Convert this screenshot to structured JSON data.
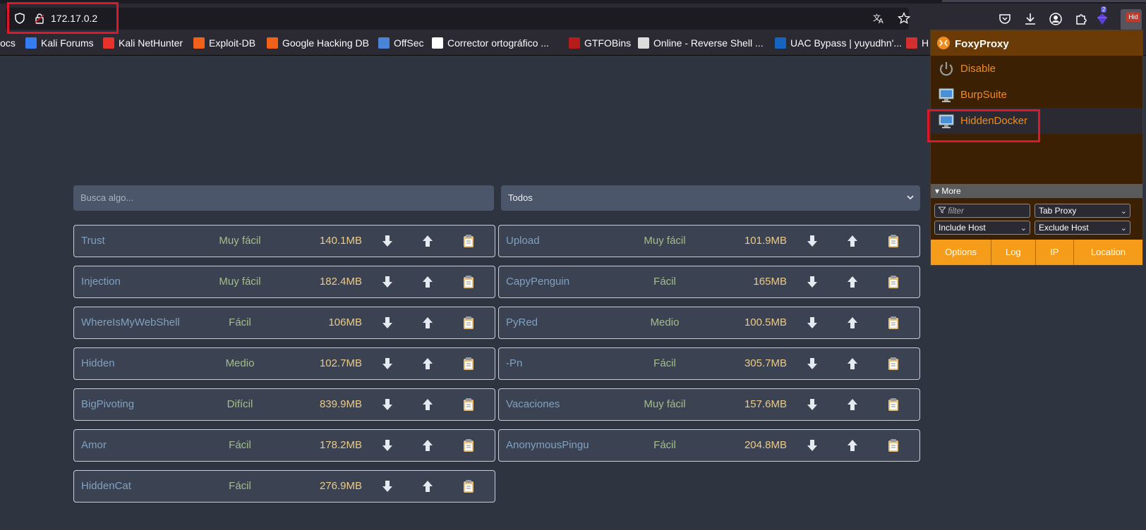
{
  "browser": {
    "url": "172.17.0.2",
    "extension_badge": "2",
    "foxy_icon_text": "Hid"
  },
  "bookmarks": [
    {
      "label": "Docs",
      "icon": "docs-icon",
      "color": "#2b2a33"
    },
    {
      "label": "Kali Forums",
      "icon": "kali-forums-icon",
      "color": "#367bf0"
    },
    {
      "label": "Kali NetHunter",
      "icon": "nethunter-icon",
      "color": "#e8322d"
    },
    {
      "label": "Exploit-DB",
      "icon": "exploitdb-icon",
      "color": "#f0611a"
    },
    {
      "label": "Google Hacking DB",
      "icon": "ghdb-icon",
      "color": "#f0611a"
    },
    {
      "label": "OffSec",
      "icon": "offsec-icon",
      "color": "#4a84d6"
    },
    {
      "label": "Corrector ortográfico ...",
      "icon": "corrector-icon",
      "color": "#ffffff"
    },
    {
      "label": "GTFOBins",
      "icon": "gtfobins-icon",
      "color": "#b71c1c"
    },
    {
      "label": "Online - Reverse Shell ...",
      "icon": "reverse-shell-icon",
      "color": "#dddddd"
    },
    {
      "label": "UAC Bypass | yuyudhn'...",
      "icon": "uac-icon",
      "color": "#1565c0"
    },
    {
      "label": "H",
      "icon": "h-icon",
      "color": "#d32f2f"
    }
  ],
  "search": {
    "placeholder": "Busca algo..."
  },
  "filter": {
    "selected": "Todos"
  },
  "machines_left": [
    {
      "name": "Trust",
      "difficulty": "Muy fácil",
      "size": "140.1MB"
    },
    {
      "name": "Injection",
      "difficulty": "Muy fácil",
      "size": "182.4MB"
    },
    {
      "name": "WhereIsMyWebShell",
      "difficulty": "Fácil",
      "size": "106MB"
    },
    {
      "name": "Hidden",
      "difficulty": "Medio",
      "size": "102.7MB"
    },
    {
      "name": "BigPivoting",
      "difficulty": "Difícil",
      "size": "839.9MB"
    },
    {
      "name": "Amor",
      "difficulty": "Fácil",
      "size": "178.2MB"
    },
    {
      "name": "HiddenCat",
      "difficulty": "Fácil",
      "size": "276.9MB"
    }
  ],
  "machines_right": [
    {
      "name": "Upload",
      "difficulty": "Muy fácil",
      "size": "101.9MB"
    },
    {
      "name": "CapyPenguin",
      "difficulty": "Fácil",
      "size": "165MB"
    },
    {
      "name": "PyRed",
      "difficulty": "Medio",
      "size": "100.5MB"
    },
    {
      "name": "-Pn",
      "difficulty": "Fácil",
      "size": "305.7MB"
    },
    {
      "name": "Vacaciones",
      "difficulty": "Muy fácil",
      "size": "157.6MB"
    },
    {
      "name": "AnonymousPingu",
      "difficulty": "Fácil",
      "size": "204.8MB"
    }
  ],
  "foxyproxy": {
    "title": "FoxyProxy",
    "items": [
      {
        "label": "Disable",
        "icon": "power-icon"
      },
      {
        "label": "BurpSuite",
        "icon": "monitor-icon"
      },
      {
        "label": "HiddenDocker",
        "icon": "monitor-icon",
        "selected": true
      }
    ],
    "more_label": "▾ More",
    "filter_placeholder": "filter",
    "tab_proxy": "Tab Proxy",
    "include_host": "Include Host",
    "exclude_host": "Exclude Host",
    "buttons": [
      "Options",
      "Log",
      "IP",
      "Location"
    ]
  },
  "colors": {
    "page_bg": "#2e3440",
    "accent_orange": "#f59c1a",
    "name_blue": "#81a1c1",
    "difficulty_green": "#a3be8c",
    "size_yellow": "#ebcb8b",
    "highlight_red": "#e0162b"
  }
}
